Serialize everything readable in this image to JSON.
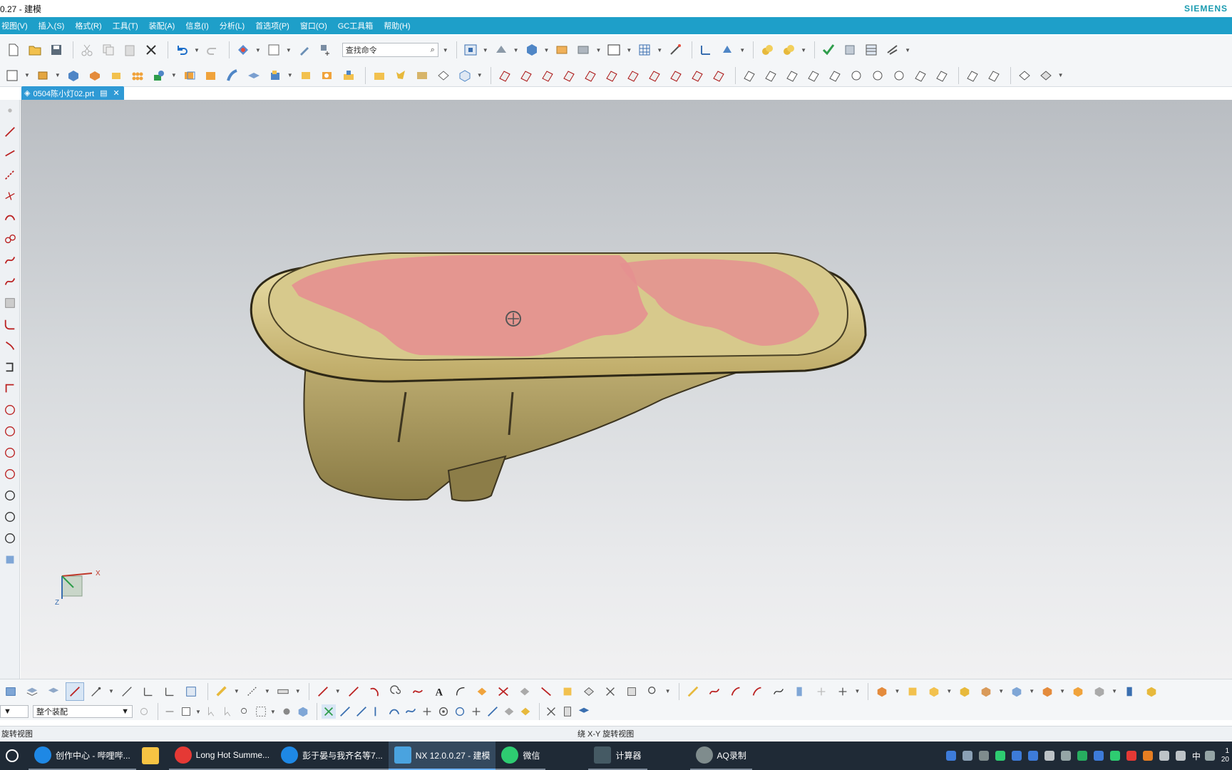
{
  "window": {
    "title": "0.27 - 建模",
    "brand": "SIEMENS"
  },
  "menu": [
    "视图(V)",
    "插入(S)",
    "格式(R)",
    "工具(T)",
    "装配(A)",
    "信息(I)",
    "分析(L)",
    "首选项(P)",
    "窗口(O)",
    "GC工具箱",
    "帮助(H)"
  ],
  "toolbar": {
    "search_placeholder": "查找命令"
  },
  "tab": {
    "label": "0504陈小灯02.prt"
  },
  "bottom": {
    "filter_select": "整个装配"
  },
  "status": {
    "left": "旋转视图",
    "center": "绕 X-Y 旋转视图"
  },
  "triad": {
    "x_label": "X",
    "z_label": "Z"
  },
  "taskbar": {
    "items": [
      {
        "label": "创作中心 - 哔哩哔...",
        "color": "#1e88e5"
      },
      {
        "label": "",
        "color": "#f6c343"
      },
      {
        "label": "Long Hot Summe...",
        "color": "#e53935"
      },
      {
        "label": "彭于晏与我齐名等7...",
        "color": "#1e88e5"
      },
      {
        "label": "NX 12.0.0.27 - 建模",
        "color": "#4aa3df"
      },
      {
        "label": "微信",
        "color": "#2ecc71"
      },
      {
        "label": "计算器",
        "color": "#455a64"
      },
      {
        "label": "AQ录制",
        "color": "#7f8c8d"
      }
    ],
    "ime": "中",
    "clock_top": "1",
    "clock_bottom": "20"
  }
}
